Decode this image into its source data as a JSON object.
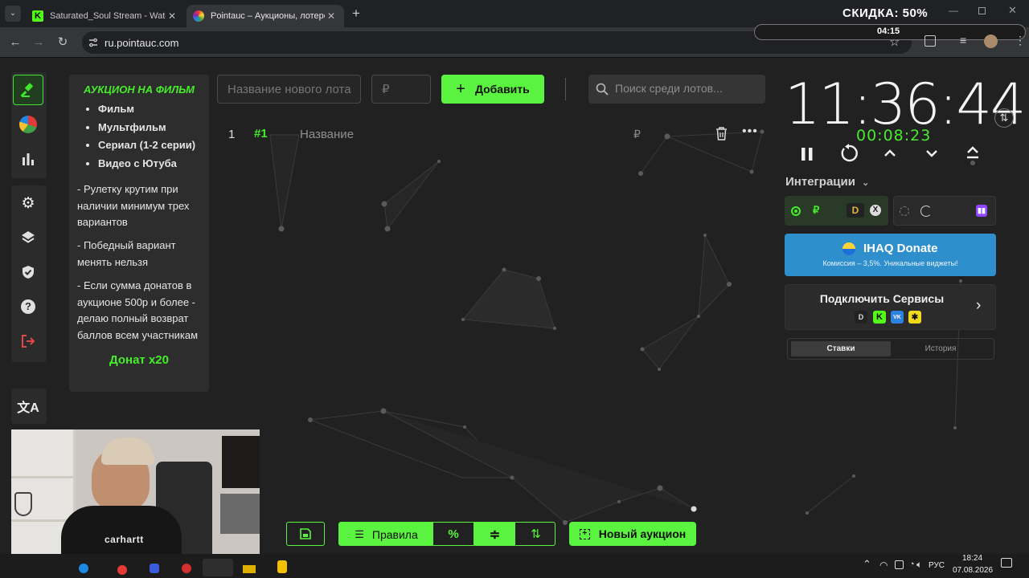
{
  "browser": {
    "tabs": [
      {
        "title": "Saturated_Soul Stream - Watch"
      },
      {
        "title": "Pointauc – Аукционы, лотереи"
      }
    ],
    "url": "ru.pointauc.com",
    "promo_text": "СКИДКА: 50%",
    "promo_time": "04:15"
  },
  "rules": {
    "title": "АУКЦИОН НА ФИЛЬМ",
    "items": [
      "Фильм",
      "Мультфильм",
      "Сериал (1-2 серии)",
      "Видео с Ютуба"
    ],
    "paragraphs": [
      "- Рулетку крутим при наличии минимум трех вариантов",
      "- Победный вариант менять нельзя",
      "-  Если сумма донатов в аукционе 500р и более - делаю полный возврат баллов всем участникам"
    ],
    "donate": "Донат х20"
  },
  "toolbar": {
    "lot_name_placeholder": "Название нового лота",
    "amount_placeholder": "₽",
    "add_label": "Добавить",
    "search_placeholder": "Поиск среди лотов..."
  },
  "lot": {
    "index": "1",
    "id": "#1",
    "name_placeholder": "Название",
    "currency": "₽"
  },
  "timer": {
    "main": "11:36:44",
    "elapsed": "00:08:23"
  },
  "integrations": {
    "title": "Интеграции",
    "donate_title": "IHAQ Donate",
    "donate_subtitle": "Комиссия – 3,5%. Уникальные виджеты!",
    "connect_title": "Подключить Сервисы",
    "tabs": [
      "Ставки",
      "История"
    ],
    "active_tab": "Ставки"
  },
  "bottom": {
    "rules_label": "Правила",
    "new_auction_label": "Новый аукцион"
  },
  "webcam": {
    "shirt_text": "carhartt"
  },
  "taskbar": {
    "lang": "РУС",
    "time": "18:24",
    "date": "07.08.2026"
  },
  "colors": {
    "accent": "#5af33f",
    "accent_text": "#46ec2b",
    "donate_panel": "#2f8fcc",
    "background": "#212121"
  }
}
